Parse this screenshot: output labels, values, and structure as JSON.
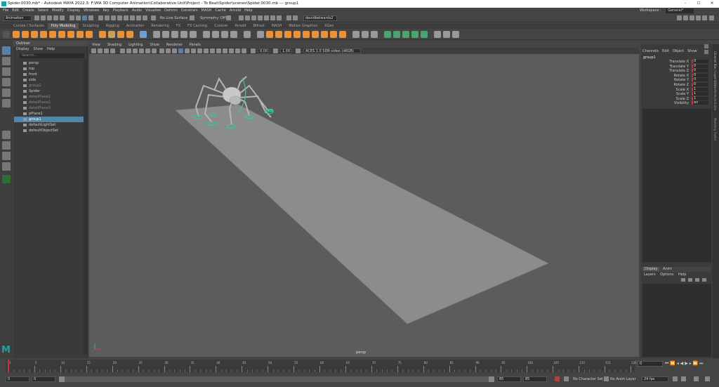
{
  "window": {
    "title": "Spider.0030.mb* - Autodesk MAYA 2022.3: F:\\MA 3D Computer Animation\\Collaborative Unit\\Project - To Beat\\Spider\\scenes\\Spider.0030.mb --- group1",
    "minimize": "–",
    "maximize": "☐",
    "close": "✕"
  },
  "menubar": [
    "File",
    "Edit",
    "Create",
    "Select",
    "Modify",
    "Display",
    "Windows",
    "Key",
    "Playback",
    "Audio",
    "Visualize",
    "Deform",
    "Constrain",
    "MASH",
    "Cache",
    "Arnold",
    "Help"
  ],
  "workspace": {
    "label": "Workspace :",
    "value": "General*"
  },
  "statusline": {
    "mode": "Animation",
    "live_surface": "No Live Surface",
    "symmetry": "Symmetry: Off",
    "user": "davidbelwards2"
  },
  "shelf_tabs": [
    "Curves / Surfaces",
    "Poly Modeling",
    "Sculpting",
    "Rigging",
    "Animation",
    "Rendering",
    "FX",
    "FX Caching",
    "Custom",
    "Arnold",
    "Bifrost",
    "MASH",
    "Motion Graphics",
    "XGen"
  ],
  "shelf_active": "Poly Modeling",
  "outliner": {
    "title": "Outliner",
    "menu": [
      "Display",
      "Show",
      "Help"
    ],
    "search_placeholder": "Search...",
    "items": [
      "persp",
      "top",
      "front",
      "side",
      "group2",
      "Spider",
      "detailPlane1",
      "detailPlane2",
      "detailPlane3",
      "pPlane1",
      "group1",
      "defaultLightSet",
      "defaultObjectSet"
    ],
    "selected": "group1"
  },
  "viewport": {
    "menu": [
      "View",
      "Shading",
      "Lighting",
      "Show",
      "Renderer",
      "Panels"
    ],
    "exposure": "0.00",
    "gamma": "1.00",
    "color_space": "ACES 1.0 SDR-video (sRGB)",
    "camera_label": "persp"
  },
  "channelbox": {
    "menu": [
      "Channels",
      "Edit",
      "Object",
      "Show"
    ],
    "object": "group1",
    "channels": [
      {
        "label": "Translate X",
        "value": "0"
      },
      {
        "label": "Translate Y",
        "value": "0"
      },
      {
        "label": "Translate Z",
        "value": "0"
      },
      {
        "label": "Rotate X",
        "value": "0"
      },
      {
        "label": "Rotate Y",
        "value": "0"
      },
      {
        "label": "Rotate Z",
        "value": "0"
      },
      {
        "label": "Scale X",
        "value": "1"
      },
      {
        "label": "Scale Y",
        "value": "1"
      },
      {
        "label": "Scale Z",
        "value": "1"
      },
      {
        "label": "Visibility",
        "value": "on"
      }
    ]
  },
  "layers": {
    "tabs": [
      "Display",
      "Anim"
    ],
    "menu": [
      "Layers",
      "Options",
      "Help"
    ]
  },
  "right_strip": [
    "Channel Box / Layer Editor",
    "Attribute Editor",
    "Modeling Toolkit"
  ],
  "timeslider": {
    "ticks": [
      "1",
      "5",
      "10",
      "15",
      "20",
      "25",
      "30",
      "35",
      "40",
      "45",
      "50",
      "55",
      "60",
      "65",
      "70",
      "75",
      "80",
      "85",
      "90",
      "95",
      "100",
      "105",
      "110",
      "115",
      "120"
    ],
    "current_frame": "0"
  },
  "range": {
    "start": "0",
    "anim_start": "0",
    "end": "85",
    "anim_end": "85",
    "character_set": "No Character Set",
    "anim_layer": "No Anim Layer",
    "fps": "24 fps"
  },
  "colors": {
    "accent": "#5aa9e6",
    "selection": "#4ecf8a",
    "shelf_orange": "#e8923a"
  }
}
